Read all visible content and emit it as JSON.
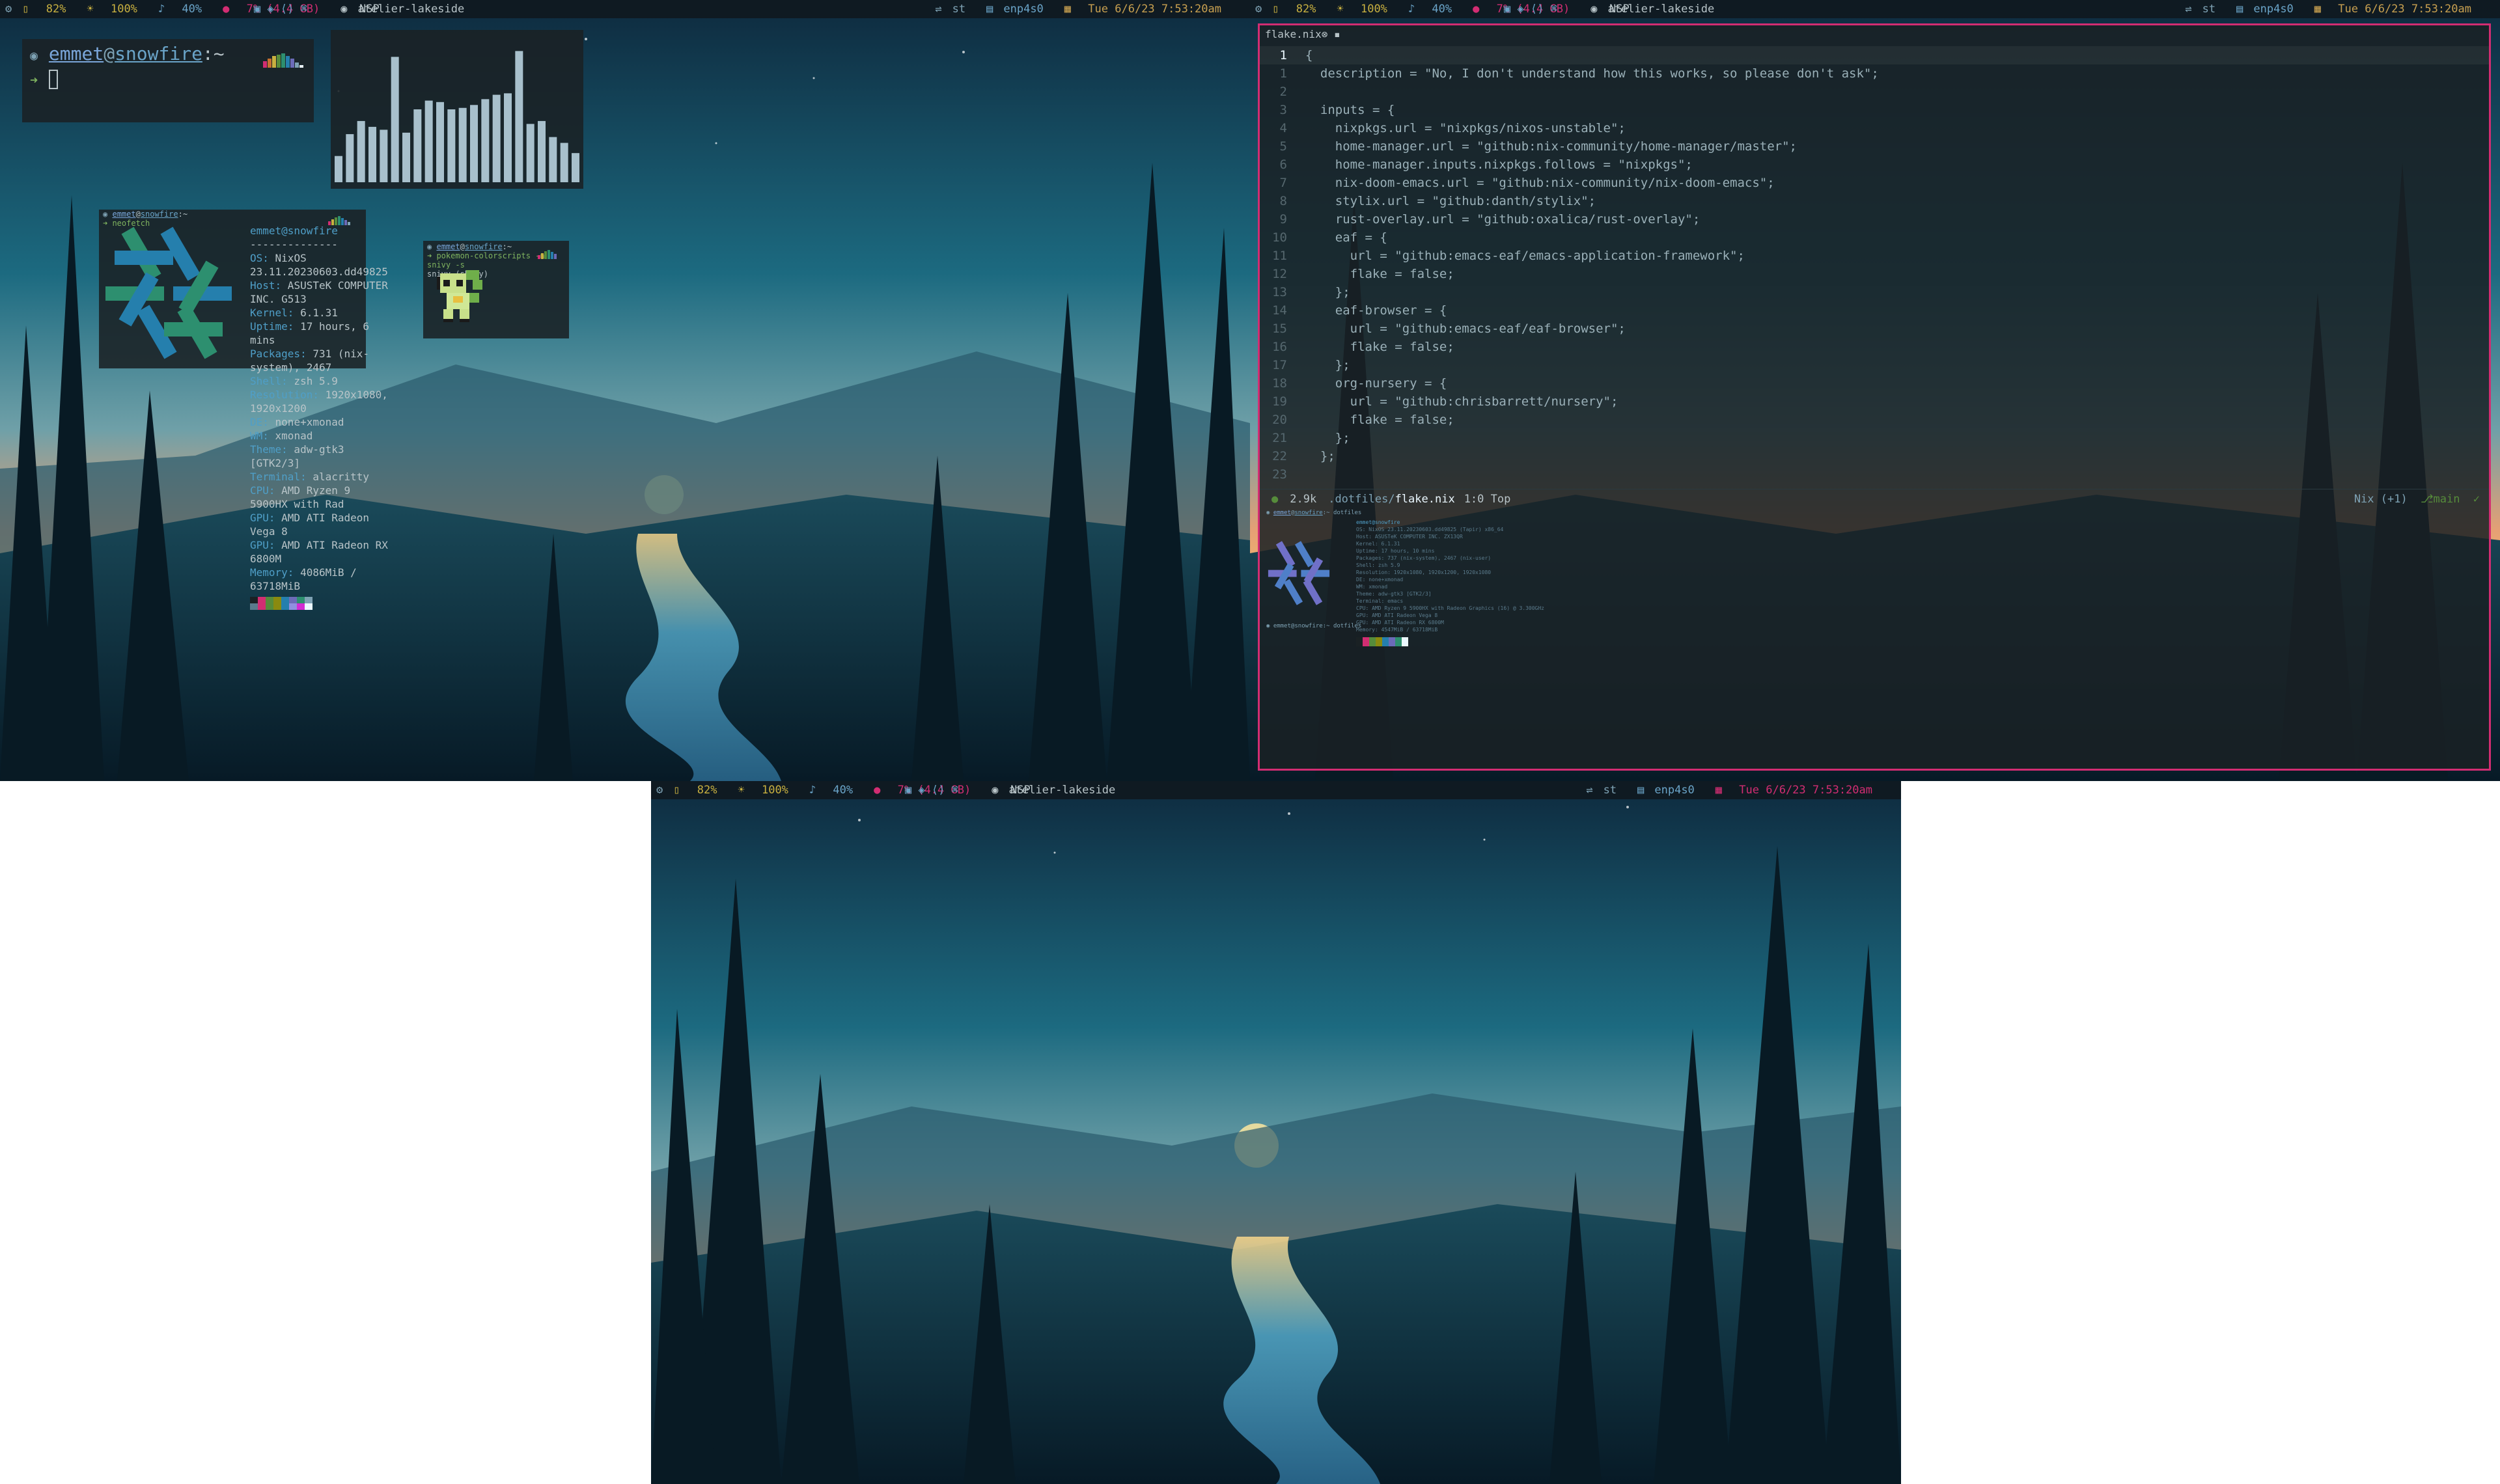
{
  "statusbar": {
    "battery": "82%",
    "brightness": "100%",
    "volume": "40%",
    "memory": "7% (4.4 GB)",
    "theme": "atelier-lakeside",
    "scratchpad": "NSP",
    "layout": "st",
    "network": "enp4s0",
    "datetime": "Tue 6/6/23 7:53:20am"
  },
  "terminal": {
    "user": "emmet",
    "host": "snowfire",
    "suffix": ":~",
    "arrow": "➜"
  },
  "visualizer_bars": [
    0.18,
    0.33,
    0.42,
    0.38,
    0.36,
    0.86,
    0.34,
    0.5,
    0.56,
    0.55,
    0.5,
    0.51,
    0.53,
    0.57,
    0.6,
    0.61,
    0.9,
    0.4,
    0.42,
    0.31,
    0.27,
    0.2
  ],
  "neofetch": {
    "prompt_user": "emmet",
    "prompt_host": "snowfire",
    "prompt_suffix": ":~",
    "command": "➜ neofetch",
    "title": "emmet@snowfire",
    "separator": "--------------",
    "lines": [
      {
        "key": "OS:",
        "val": " NixOS 23.11.20230603.dd49825"
      },
      {
        "key": "Host:",
        "val": " ASUSTeK COMPUTER INC. G513"
      },
      {
        "key": "Kernel:",
        "val": " 6.1.31"
      },
      {
        "key": "Uptime:",
        "val": " 17 hours, 6 mins"
      },
      {
        "key": "Packages:",
        "val": " 731 (nix-system), 2467"
      },
      {
        "key": "Shell:",
        "val": " zsh 5.9"
      },
      {
        "key": "Resolution:",
        "val": " 1920x1080, 1920x1200"
      },
      {
        "key": "DE:",
        "val": " none+xmonad"
      },
      {
        "key": "WM:",
        "val": " xmonad"
      },
      {
        "key": "Theme:",
        "val": " adw-gtk3 [GTK2/3]"
      },
      {
        "key": "Terminal:",
        "val": " alacritty"
      },
      {
        "key": "CPU:",
        "val": " AMD Ryzen 9 5900HX with Rad"
      },
      {
        "key": "GPU:",
        "val": " AMD ATI Radeon Vega 8"
      },
      {
        "key": "GPU:",
        "val": " AMD ATI Radeon RX 6800M"
      },
      {
        "key": "Memory:",
        "val": " 4086MiB / 63718MiB"
      }
    ],
    "palette_top": [
      "#1a2124",
      "#d22d72",
      "#568c3b",
      "#8a8a0f",
      "#257fad",
      "#6b6bb8",
      "#2d8f6f",
      "#7ea2b4"
    ],
    "palette_bottom": [
      "#5a7b8c",
      "#d22d72",
      "#568c3b",
      "#8a8a0f",
      "#257fad",
      "#9090e0",
      "#d22dd2",
      "#ebf8ff"
    ]
  },
  "pokemon": {
    "prompt_user": "emmet",
    "prompt_host": "snowfire",
    "prompt_suffix": ":~",
    "command": "➜ pokemon-colorscripts -n snivy -s",
    "name": "snivy (shiny)"
  },
  "editor": {
    "tab": "flake.nix",
    "lines": [
      {
        "n": "1",
        "text": "{"
      },
      {
        "n": "1",
        "text": "  description = \"No, I don't understand how this works, so please don't ask\";"
      },
      {
        "n": "2",
        "text": ""
      },
      {
        "n": "3",
        "text": "  inputs = {"
      },
      {
        "n": "4",
        "text": "    nixpkgs.url = \"nixpkgs/nixos-unstable\";"
      },
      {
        "n": "5",
        "text": "    home-manager.url = \"github:nix-community/home-manager/master\";"
      },
      {
        "n": "6",
        "text": "    home-manager.inputs.nixpkgs.follows = \"nixpkgs\";"
      },
      {
        "n": "7",
        "text": "    nix-doom-emacs.url = \"github:nix-community/nix-doom-emacs\";"
      },
      {
        "n": "8",
        "text": "    stylix.url = \"github:danth/stylix\";"
      },
      {
        "n": "9",
        "text": "    rust-overlay.url = \"github:oxalica/rust-overlay\";"
      },
      {
        "n": "10",
        "text": "    eaf = {"
      },
      {
        "n": "11",
        "text": "      url = \"github:emacs-eaf/emacs-application-framework\";"
      },
      {
        "n": "12",
        "text": "      flake = false;"
      },
      {
        "n": "13",
        "text": "    };"
      },
      {
        "n": "14",
        "text": "    eaf-browser = {"
      },
      {
        "n": "15",
        "text": "      url = \"github:emacs-eaf/eaf-browser\";"
      },
      {
        "n": "16",
        "text": "      flake = false;"
      },
      {
        "n": "17",
        "text": "    };"
      },
      {
        "n": "18",
        "text": "    org-nursery = {"
      },
      {
        "n": "19",
        "text": "      url = \"github:chrisbarrett/nursery\";"
      },
      {
        "n": "20",
        "text": "      flake = false;"
      },
      {
        "n": "21",
        "text": "    };"
      },
      {
        "n": "22",
        "text": "  };"
      },
      {
        "n": "23",
        "text": ""
      }
    ],
    "modeline": {
      "size": "2.9k",
      "path": ".dotfiles/",
      "file": "flake.nix",
      "pos": "1:0 Top",
      "mode": "Nix (+1)",
      "branch": "main",
      "check": "✓"
    }
  },
  "mini_terminal": {
    "prompt_user": "emmet",
    "prompt_host": "snowfire",
    "prompt_suffix": ":~ dotfiles",
    "title": "emmet@snowfire",
    "lines": [
      "OS: NixOS 23.11.20230603.dd49825 (Tapir) x86_64",
      "Host: ASUSTeK COMPUTER INC. ZX13QR",
      "Kernel: 6.1.31",
      "Uptime: 17 hours, 10 mins",
      "Packages: 737 (nix-system), 2467 (nix-user)",
      "Shell: zsh 5.9",
      "Resolution: 1920x1080, 1920x1200, 1920x1080",
      "DE: none+xmonad",
      "WM: xmonad",
      "Theme: adw-gtk3 [GTK2/3]",
      "Terminal: emacs",
      "CPU: AMD Ryzen 9 5900HX with Radeon Graphics (16) @ 3.300GHz",
      "GPU: AMD ATI Radeon Vega 8",
      "GPU: AMD ATI Radeon RX 6800M",
      "Memory: 4547MiB / 63718MiB"
    ],
    "end_prompt": "emmet@snowfire:~ dotfiles"
  }
}
